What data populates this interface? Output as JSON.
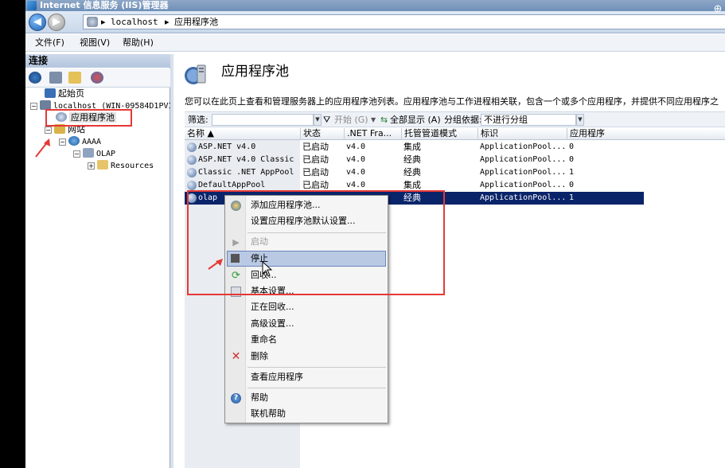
{
  "window": {
    "title": "Internet 信息服务 (IIS)管理器"
  },
  "address": {
    "segments": [
      "localhost",
      "应用程序池"
    ],
    "separator": "▸"
  },
  "menu": [
    "文件(F)",
    "视图(V)",
    "帮助(H)"
  ],
  "connections": {
    "header": "连接",
    "tree": [
      {
        "label": "起始页",
        "level": 1
      },
      {
        "label": "localhost (WIN-09584D1PVI",
        "level": 0
      },
      {
        "label": "应用程序池",
        "level": 2
      },
      {
        "label": "网站",
        "level": 1
      },
      {
        "label": "AAAA",
        "level": 2
      },
      {
        "label": "OLAP",
        "level": 3
      },
      {
        "label": "Resources",
        "level": 4
      }
    ]
  },
  "page": {
    "title": "应用程序池",
    "description": "您可以在此页上查看和管理服务器上的应用程序池列表。应用程序池与工作进程相关联，包含一个或多个应用程序，并提供不同应用程序之"
  },
  "filter": {
    "label": "筛选:",
    "start_label": "开始 (G)",
    "show_all_label": "全部显示 (A)",
    "group_by_label": "分组依据:",
    "group_value": "不进行分组"
  },
  "grid": {
    "columns": [
      "名称",
      "状态",
      ".NET Fra...",
      "托管管道模式",
      "标识",
      "应用程序"
    ],
    "rows": [
      [
        "ASP.NET v4.0",
        "已启动",
        "v4.0",
        "集成",
        "ApplicationPool...",
        "0"
      ],
      [
        "ASP.NET v4.0 Classic",
        "已启动",
        "v4.0",
        "经典",
        "ApplicationPool...",
        "0"
      ],
      [
        "Classic .NET AppPool",
        "已启动",
        "v4.0",
        "经典",
        "ApplicationPool...",
        "1"
      ],
      [
        "DefaultAppPool",
        "已启动",
        "v4.0",
        "集成",
        "ApplicationPool...",
        "0"
      ],
      [
        "olap",
        "",
        "",
        "经典",
        "ApplicationPool...",
        "1"
      ]
    ]
  },
  "context_menu": {
    "items": [
      {
        "label": "添加应用程序池...",
        "icon": "add-pool-icon"
      },
      {
        "label": "设置应用程序池默认设置...",
        "icon": ""
      },
      {
        "label": "启动",
        "icon": "play-icon",
        "disabled": true
      },
      {
        "label": "停止",
        "icon": "stop-icon",
        "highlighted": true
      },
      {
        "label": "回收...",
        "icon": "recycle-icon"
      },
      {
        "label": "基本设置...",
        "icon": "settings-icon"
      },
      {
        "label": "正在回收...",
        "icon": ""
      },
      {
        "label": "高级设置...",
        "icon": ""
      },
      {
        "label": "重命名",
        "icon": ""
      },
      {
        "label": "删除",
        "icon": "delete-icon"
      },
      {
        "label": "查看应用程序",
        "icon": ""
      },
      {
        "label": "帮助",
        "icon": "help-icon"
      },
      {
        "label": "联机帮助",
        "icon": ""
      }
    ]
  },
  "colors": {
    "annotation": "#e53935",
    "selection": "#0a246a"
  }
}
